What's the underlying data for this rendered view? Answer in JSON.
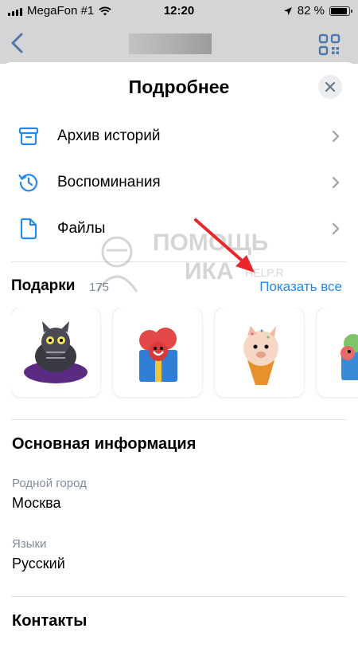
{
  "status_bar": {
    "carrier": "MegaFon #1",
    "time": "12:20",
    "battery": "82 %"
  },
  "sheet": {
    "title": "Подробнее"
  },
  "menu": [
    {
      "label": "Архив историй",
      "icon": "archive-icon"
    },
    {
      "label": "Воспоминания",
      "icon": "history-icon"
    },
    {
      "label": "Файлы",
      "icon": "file-icon"
    }
  ],
  "gifts": {
    "title": "Подарки",
    "count": "175",
    "show_all": "Показать все"
  },
  "main_info": {
    "title": "Основная информация",
    "hometown_label": "Родной город",
    "hometown_value": "Москва",
    "languages_label": "Языки",
    "languages_value": "Русский"
  },
  "contacts": {
    "title": "Контакты"
  },
  "watermark": {
    "line1": "ПОМОЩЬ",
    "line2": "ИКА",
    "line3": "HELP.R"
  },
  "colors": {
    "accent": "#2688eb",
    "secondary_text": "#818c99",
    "annotation_arrow": "#e8262b"
  }
}
